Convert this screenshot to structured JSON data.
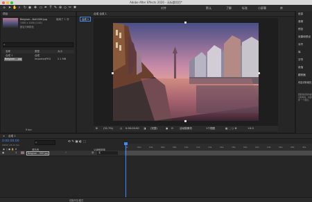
{
  "titlebar": {
    "title": "Adobe After Effects 2020 - 无标题项目*"
  },
  "toolbar": {
    "workspaces": [
      "默认",
      "了解",
      "标准",
      "小屏幕",
      "库"
    ],
    "tools": [
      "home-icon",
      "select-icon",
      "hand-icon",
      "zoom-icon",
      "rotate-icon",
      "camera-icon",
      "pan-icon",
      "rect-icon",
      "pen-icon",
      "text-icon",
      "brush-icon",
      "clone-icon",
      "eraser-icon",
      "roto-icon",
      "puppet-icon"
    ],
    "extra": "对齐"
  },
  "project": {
    "tab": "项目",
    "selected_file": "Belgium...8xt1000.jpg",
    "selected_used": "使用了 1 次",
    "selected_meta1": "1500 x 1000 (1.00)",
    "selected_meta2": "数百万种颜色",
    "search_placeholder": "ρ",
    "col_name": "名称",
    "col_type": "类型",
    "col_size": "大小",
    "items": [
      {
        "name": "合成 1",
        "type": "合成",
        "size": ""
      },
      {
        "name": "Belgium....jpg",
        "type": "ImporterJPEG",
        "size": "2.1 MB"
      }
    ],
    "bpc": "8 bpc"
  },
  "composition": {
    "tab": "合成 合成 1",
    "subtab": "合成 1",
    "zoom": "(31.7%)",
    "time": "0:00:00:00",
    "quality": "(完整)",
    "camera": "活动摄像机",
    "views": "1个视图",
    "offset": "+0.0"
  },
  "right_panel": {
    "items": [
      "信息",
      "音频",
      "预览",
      "效果和预设",
      "对齐",
      "库",
      "字符",
      "段落",
      "跟踪器",
      "内容识别填充"
    ],
    "note": "要能够使用内容识别填充，请选择 一个图层。"
  },
  "timeline": {
    "tab": "合成 1",
    "timecode": "0:00:00:00",
    "fps": "00000 (25.00 fps)",
    "search_placeholder": "ρ",
    "col_source": "源名称",
    "col_parent": "父级和链接",
    "layer_index": "1",
    "layer_name": "Belgium....000.jpg",
    "layer_parent": "无",
    "ticks": [
      "0s",
      "02s",
      "04s",
      "06s",
      "08s",
      "10s",
      "12s",
      "14s",
      "16s",
      "18s",
      "20s",
      "22s",
      "24s",
      "26s",
      "28s",
      "30s"
    ],
    "bottom_label": "切换开关/模式"
  },
  "colors": {
    "accent": "#3d8bff",
    "background": "#232323",
    "panel": "#262626"
  }
}
